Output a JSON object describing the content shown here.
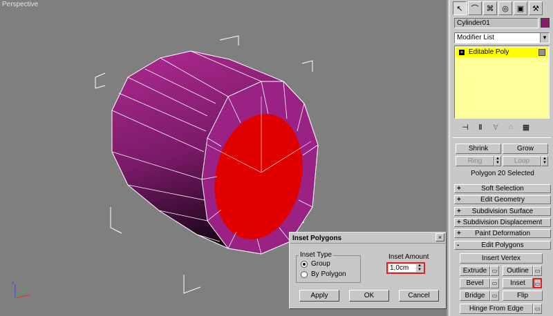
{
  "viewport": {
    "label": "Perspective",
    "object_color": "#8a1a6a",
    "selection_color": "#e00000"
  },
  "panel": {
    "tabs": [
      {
        "icon": "arrow-pointer-icon",
        "glyph": "↖",
        "active": true
      },
      {
        "icon": "curve-icon",
        "glyph": "⌒",
        "active": false
      },
      {
        "icon": "hierarchy-icon",
        "glyph": "⌘",
        "active": false
      },
      {
        "icon": "motion-icon",
        "glyph": "◎",
        "active": false
      },
      {
        "icon": "display-icon",
        "glyph": "▣",
        "active": false
      },
      {
        "icon": "utilities-icon",
        "glyph": "⚒",
        "active": false
      }
    ],
    "object_name": "Cylinder01",
    "modifier_list": "Modifier List",
    "stack_item": "Editable Poly",
    "selection": {
      "shrink": "Shrink",
      "grow": "Grow",
      "ring": "Ring",
      "loop": "Loop",
      "status": "Polygon 20 Selected"
    },
    "rollouts": [
      {
        "sign": "+",
        "label": "Soft Selection"
      },
      {
        "sign": "+",
        "label": "Edit Geometry"
      },
      {
        "sign": "+",
        "label": "Subdivision Surface"
      },
      {
        "sign": "+",
        "label": "Subdivision Displacement"
      },
      {
        "sign": "+",
        "label": "Paint Deformation"
      },
      {
        "sign": "-",
        "label": "Edit Polygons"
      }
    ],
    "edit_polygons": {
      "insert_vertex": "Insert Vertex",
      "extrude": "Extrude",
      "outline": "Outline",
      "bevel": "Bevel",
      "inset": "Inset",
      "bridge": "Bridge",
      "flip": "Flip",
      "hinge": "Hinge From Edge"
    }
  },
  "dialog": {
    "title": "Inset Polygons",
    "close": "×",
    "inset_type_label": "Inset Type",
    "option_group": "Group",
    "option_by_polygon": "By Polygon",
    "inset_amount_label": "Inset Amount",
    "inset_amount_value": "1,0cm",
    "apply": "Apply",
    "ok": "OK",
    "cancel": "Cancel"
  }
}
